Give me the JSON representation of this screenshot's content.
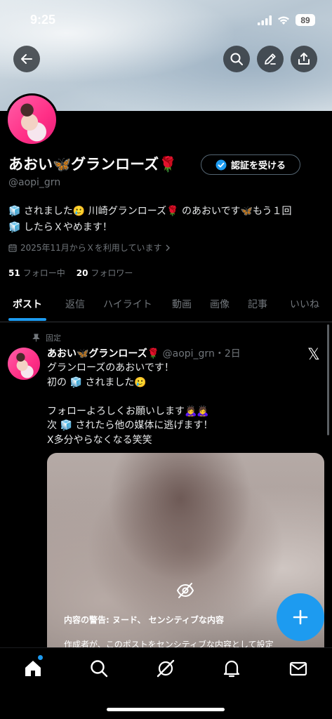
{
  "status_bar": {
    "time": "9:25",
    "battery": "89"
  },
  "profile": {
    "display_name": "あおい🦋グランローズ🌹",
    "verify_label": "認証を受ける",
    "handle": "@aopi_grn",
    "bio_line1": "🧊 されました🥲 川崎グランローズ🌹 のあおいです🦋もう１回",
    "bio_line2": "🧊 したらＸやめます！",
    "joined": "2025年11月からＸを利用しています",
    "following_count": "51",
    "following_label": "フォロー中",
    "followers_count": "20",
    "followers_label": "フォロワー"
  },
  "tabs": [
    "ポスト",
    "返信",
    "ハイライト",
    "動画",
    "画像",
    "記事",
    "いいね"
  ],
  "post": {
    "pinned_label": "固定",
    "author_name": "あおい🦋グランローズ🌹",
    "meta": "@aopi_grn・2日",
    "lines": [
      "グランローズのあおいです！",
      "初の 🧊 されました🥲",
      "",
      "フォローよろしくお願いします🙇‍♀️🙇‍♀️",
      "次 🧊 されたら他の媒体に逃げます！",
      "X多分やらなくなる笑笑"
    ],
    "warning_title": "内容の警告: ヌード、 センシティブな内容",
    "warning_body": "作成者が、このポストをセンシティブな内容として設定"
  },
  "colors": {
    "accent": "#1d9bf0",
    "muted": "#71767b"
  },
  "icons": [
    "back-icon",
    "search-icon",
    "edit-icon",
    "share-icon",
    "verified-icon",
    "calendar-icon",
    "pin-icon",
    "x-logo-icon",
    "eye-off-icon",
    "plus-icon",
    "home-icon",
    "grok-icon",
    "bell-icon",
    "mail-icon"
  ]
}
